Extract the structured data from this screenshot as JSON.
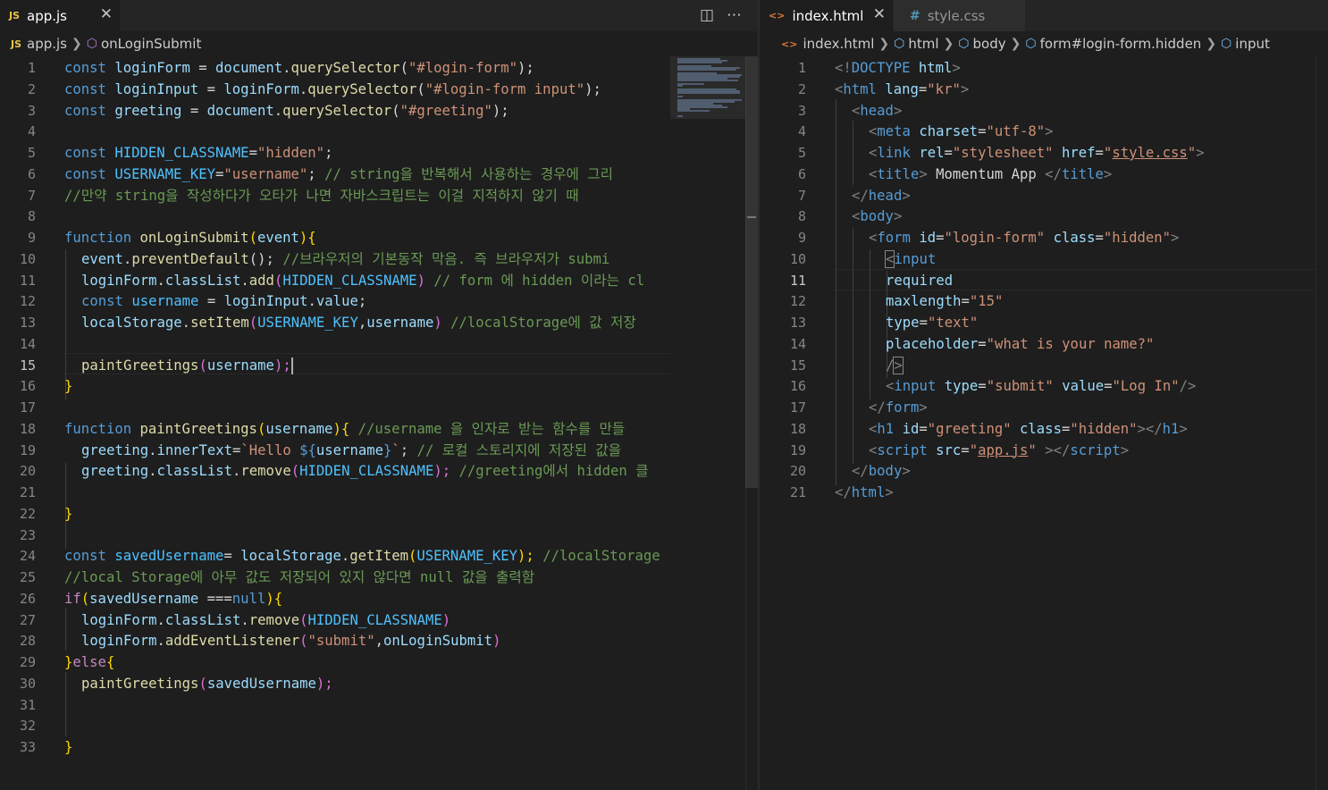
{
  "left_editor": {
    "tab": {
      "icon": "JS",
      "label": "app.js",
      "close": "✕"
    },
    "actions": {
      "split": "◫",
      "more": "⋯"
    },
    "breadcrumb": {
      "file_icon": "JS",
      "file": "app.js",
      "symbol": "onLoginSubmit"
    },
    "current_line": 15,
    "line_numbers": [
      "1",
      "2",
      "3",
      "4",
      "5",
      "6",
      "7",
      "8",
      "9",
      "10",
      "11",
      "12",
      "13",
      "14",
      "15",
      "16",
      "17",
      "18",
      "19",
      "20",
      "21",
      "22",
      "23",
      "24",
      "25",
      "26",
      "27",
      "28",
      "29",
      "30",
      "31",
      "32",
      "33"
    ]
  },
  "right_editor": {
    "tabs": [
      {
        "icon": "<>",
        "label": "index.html",
        "close": "✕",
        "active": true
      },
      {
        "icon": "#",
        "label": "style.css",
        "active": false
      }
    ],
    "breadcrumb": [
      "index.html",
      "html",
      "body",
      "form#login-form.hidden",
      "input"
    ],
    "current_line": 11,
    "line_numbers": [
      "1",
      "2",
      "3",
      "4",
      "5",
      "6",
      "7",
      "8",
      "9",
      "10",
      "11",
      "12",
      "13",
      "14",
      "15",
      "16",
      "17",
      "18",
      "19",
      "20",
      "21"
    ]
  },
  "js_code": {
    "l1": [
      "const ",
      "loginForm",
      " = ",
      "document",
      ".",
      "querySelector",
      "(",
      "\"#login-form\"",
      ");"
    ],
    "l2": [
      "const ",
      "loginInput",
      " = ",
      "loginForm",
      ".",
      "querySelector",
      "(",
      "\"#login-form input\"",
      ");"
    ],
    "l3": [
      "const ",
      "greeting",
      " = ",
      "document",
      ".",
      "querySelector",
      "(",
      "\"#greeting\"",
      ");"
    ],
    "l5": [
      "const ",
      "HIDDEN_CLASSNAME",
      "=",
      "\"hidden\"",
      ";"
    ],
    "l6": [
      "const ",
      "USERNAME_KEY",
      "=",
      "\"username\"",
      "; ",
      "// string을 반복해서 사용하는 경우에 그리"
    ],
    "l7": [
      "//만약 string을 작성하다가 오타가 나면 자바스크립트는 이걸 지적하지 않기 때"
    ],
    "l9": [
      "function ",
      "onLoginSubmit",
      "(",
      "event",
      ")",
      "{"
    ],
    "l10": [
      "event",
      ".",
      "preventDefault",
      "(); ",
      "//브라우저의 기본동작 막음. 즉 브라우저가 submi"
    ],
    "l11": [
      "loginForm",
      ".",
      "classList",
      ".",
      "add",
      "(",
      "HIDDEN_CLASSNAME",
      ") ",
      "// form 에 hidden 이라는 cl"
    ],
    "l12": [
      "const ",
      "username",
      " = ",
      "loginInput",
      ".",
      "value",
      ";"
    ],
    "l13": [
      "localStorage",
      ".",
      "setItem",
      "(",
      "USERNAME_KEY",
      ",",
      "username",
      ") ",
      "//localStorage에 값 저장"
    ],
    "l15": [
      "paintGreetings",
      "(",
      "username",
      ");"
    ],
    "l16": [
      "}"
    ],
    "l18": [
      "function ",
      "paintGreetings",
      "(",
      "username",
      ")",
      "{ ",
      "//username 을 인자로 받는 함수를 만들"
    ],
    "l19": [
      "greeting",
      ".",
      "innerText",
      "=",
      "`Hello ",
      "${",
      "username",
      "}",
      "`",
      "; ",
      "// 로컬 스토리지에 저장된 값을"
    ],
    "l20": [
      "greeting",
      ".",
      "classList",
      ".",
      "remove",
      "(",
      "HIDDEN_CLASSNAME",
      "); ",
      "//greeting에서 hidden 클"
    ],
    "l22": [
      "}"
    ],
    "l24": [
      "const ",
      "savedUsername",
      "= ",
      "localStorage",
      ".",
      "getItem",
      "(",
      "USERNAME_KEY",
      "); ",
      "//localStorage"
    ],
    "l25": [
      "//local Storage에 아무 값도 저장되어 있지 않다면 null 값을 출력함"
    ],
    "l26": [
      "if",
      "(",
      "savedUsername",
      " ===",
      "null",
      ")",
      "{"
    ],
    "l27": [
      "loginForm",
      ".",
      "classList",
      ".",
      "remove",
      "(",
      "HIDDEN_CLASSNAME",
      ")"
    ],
    "l28": [
      "loginForm",
      ".",
      "addEventListener",
      "(",
      "\"submit\"",
      ",",
      "onLoginSubmit",
      ")"
    ],
    "l29": [
      "}",
      "else",
      "{"
    ],
    "l30": [
      "paintGreetings",
      "(",
      "savedUsername",
      ");"
    ],
    "l33": [
      "}"
    ]
  },
  "html_code": {
    "l1": [
      "<!",
      "DOCTYPE",
      " ",
      "html",
      ">"
    ],
    "l2": [
      "<",
      "html",
      " ",
      "lang",
      "=",
      "\"kr\"",
      ">"
    ],
    "l3": [
      "<",
      "head",
      ">"
    ],
    "l4": [
      "<",
      "meta",
      " ",
      "charset",
      "=",
      "\"utf-8\"",
      ">"
    ],
    "l5": [
      "<",
      "link",
      " ",
      "rel",
      "=",
      "\"stylesheet\"",
      " ",
      "href",
      "=",
      "\"",
      "style.css",
      "\"",
      ">"
    ],
    "l6": [
      "<",
      "title",
      ">",
      " Momentum App ",
      "</",
      "title",
      ">"
    ],
    "l7": [
      "</",
      "head",
      ">"
    ],
    "l8": [
      "<",
      "body",
      ">"
    ],
    "l9": [
      "<",
      "form",
      " ",
      "id",
      "=",
      "\"login-form\"",
      " ",
      "class",
      "=",
      "\"hidden\"",
      ">"
    ],
    "l10": [
      "<",
      "input"
    ],
    "l11": [
      "required"
    ],
    "l12": [
      "maxlength",
      "=",
      "\"15\""
    ],
    "l13": [
      "type",
      "=",
      "\"text\""
    ],
    "l14": [
      "placeholder",
      "=",
      "\"what is your name?\""
    ],
    "l15": [
      "/",
      ">"
    ],
    "l16": [
      "<",
      "input",
      " ",
      "type",
      "=",
      "\"submit\"",
      " ",
      "value",
      "=",
      "\"Log In\"",
      "/>"
    ],
    "l17": [
      "</",
      "form",
      ">"
    ],
    "l18": [
      "<",
      "h1",
      " ",
      "id",
      "=",
      "\"greeting\"",
      " ",
      "class",
      "=",
      "\"hidden\"",
      "></",
      "h1",
      ">"
    ],
    "l19": [
      "<",
      "script",
      " ",
      "src",
      "=",
      "\"",
      "app.js",
      "\"",
      " ></",
      "script",
      ">"
    ],
    "l20": [
      "</",
      "body",
      ">"
    ],
    "l21": [
      "</",
      "html",
      ">"
    ]
  },
  "colors": {
    "background": "#1e1e1e",
    "keyword": "#569cd6",
    "variable": "#9cdcfe",
    "constant": "#4fc1ff",
    "function": "#dcdcaa",
    "string": "#ce9178",
    "comment": "#6a9955"
  }
}
